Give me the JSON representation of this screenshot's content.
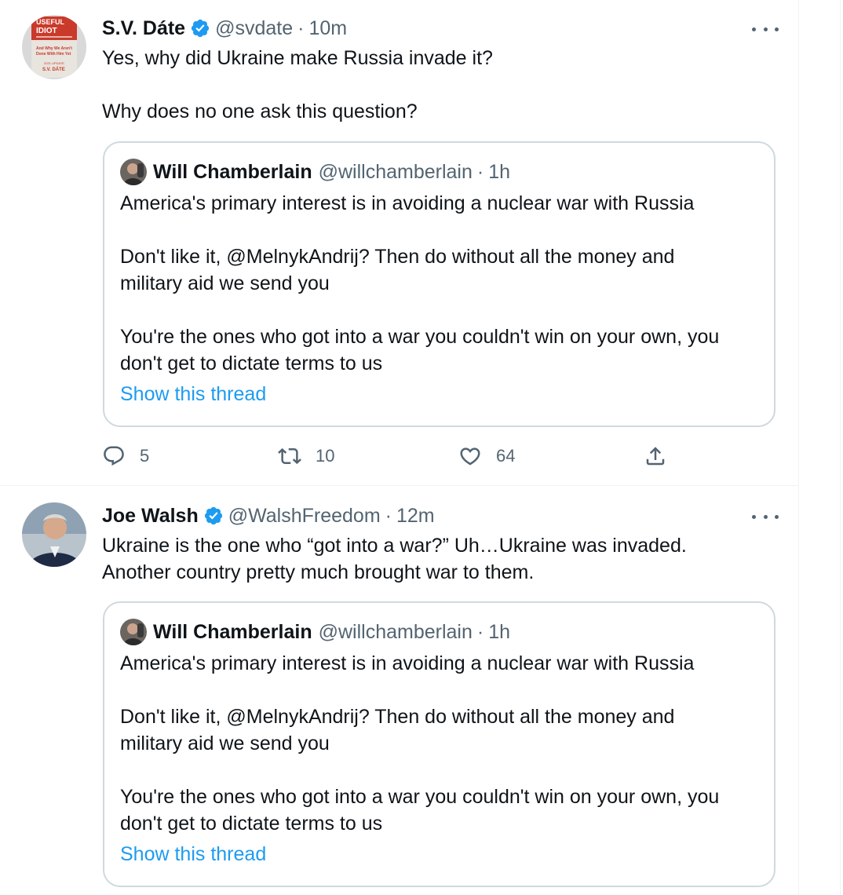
{
  "tweets": [
    {
      "author": {
        "name": "S.V. Dáte",
        "handle": "@svdate",
        "time": "10m"
      },
      "avatar_text": [
        "USEFUL",
        "IDIOT",
        "And Why We Aren't",
        "Done With Him Yet",
        "2021 UPDATE",
        "S.V. DÁTE"
      ],
      "text": [
        "Yes, why did Ukraine make Russia invade it?",
        "Why does no one ask this question?"
      ],
      "quote": {
        "name": "Will Chamberlain",
        "handle": "@willchamberlain",
        "time": "1h",
        "text": [
          "America's primary interest is in avoiding a nuclear war with Russia",
          "Don't like it, @MelnykAndrij? Then do without all the money and",
          "military aid we send you",
          "You're the ones who got into a war you couldn't win on your own, you",
          "don't get to dictate terms to us"
        ],
        "link": "Show this thread"
      },
      "stats": {
        "replies": "5",
        "retweets": "10",
        "likes": "64"
      }
    },
    {
      "author": {
        "name": "Joe Walsh",
        "handle": "@WalshFreedom",
        "time": "12m"
      },
      "text": [
        "Ukraine is the one who “got into a war?” Uh…Ukraine was invaded.",
        "Another country pretty much brought war to them."
      ],
      "quote": {
        "name": "Will Chamberlain",
        "handle": "@willchamberlain",
        "time": "1h",
        "text": [
          "America's primary interest is in avoiding a nuclear war with Russia",
          "Don't like it, @MelnykAndrij? Then do without all the money and",
          "military aid we send you",
          "You're the ones who got into a war you couldn't win on your own, you",
          "don't get to dictate terms to us"
        ],
        "link": "Show this thread"
      }
    }
  ],
  "ui": {
    "separator": "·"
  },
  "icons": {
    "verified": "verified-badge-icon",
    "more": "more-options-icon",
    "reply": "reply-icon",
    "retweet": "retweet-icon",
    "like": "like-icon",
    "share": "share-icon"
  },
  "colors": {
    "text": "#0f1419",
    "secondary": "#536471",
    "link": "#1d9bf0",
    "verified": "#1d9bf0",
    "border": "#cfd9de"
  }
}
